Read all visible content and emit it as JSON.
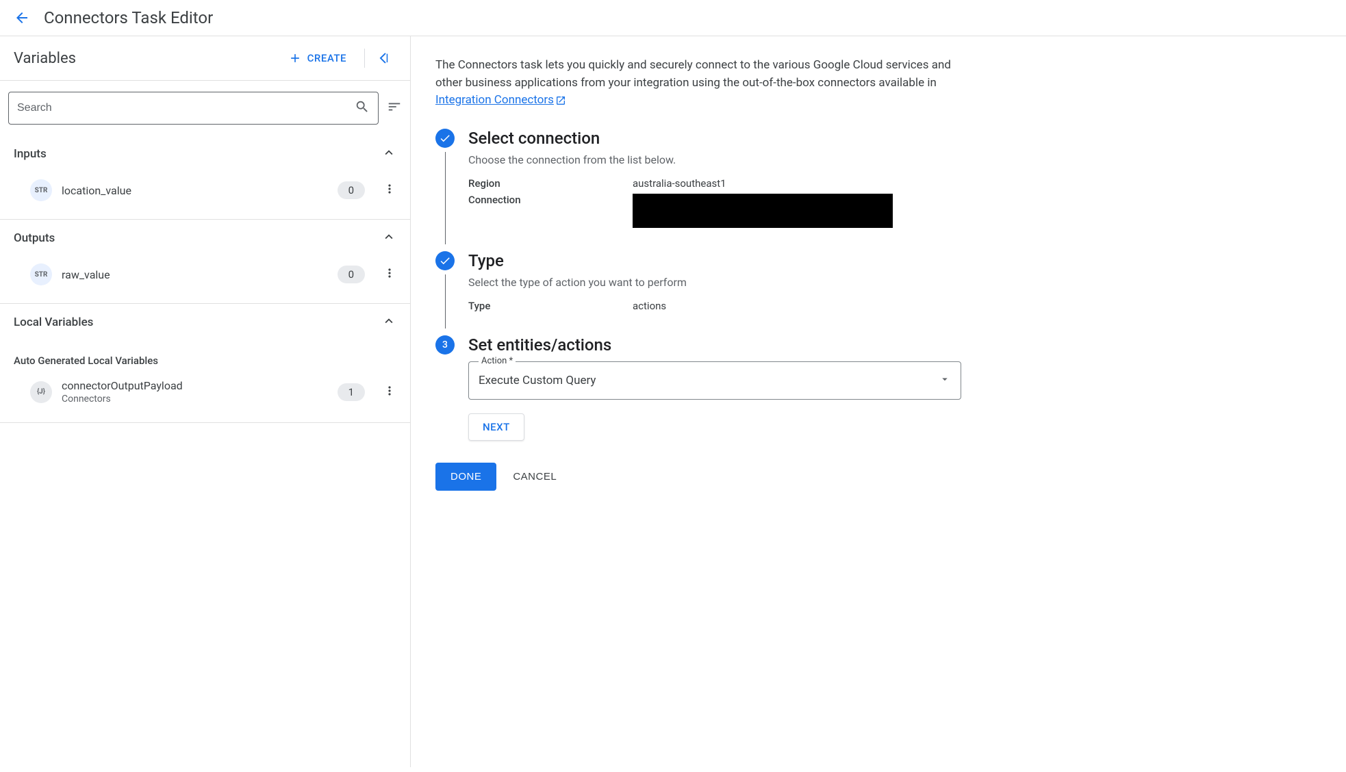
{
  "header": {
    "title": "Connectors Task Editor"
  },
  "leftPanel": {
    "title": "Variables",
    "createLabel": "CREATE",
    "searchPlaceholder": "Search",
    "sections": {
      "inputs": {
        "title": "Inputs",
        "items": [
          {
            "type": "STR",
            "name": "location_value",
            "count": "0"
          }
        ]
      },
      "outputs": {
        "title": "Outputs",
        "items": [
          {
            "type": "STR",
            "name": "raw_value",
            "count": "0"
          }
        ]
      },
      "localVars": {
        "title": "Local Variables",
        "subtitle": "Auto Generated Local Variables",
        "items": [
          {
            "type": "{J}",
            "name": "connectorOutputPayload",
            "subtitle": "Connectors",
            "count": "1"
          }
        ]
      }
    }
  },
  "rightPanel": {
    "introText": "The Connectors task lets you quickly and securely connect to the various Google Cloud services and other business applications from your integration using the out-of-the-box connectors available in ",
    "introLink": "Integration Connectors",
    "steps": {
      "step1": {
        "title": "Select connection",
        "desc": "Choose the connection from the list below.",
        "regionLabel": "Region",
        "regionValue": "australia-southeast1",
        "connectionLabel": "Connection"
      },
      "step2": {
        "title": "Type",
        "desc": "Select the type of action you want to perform",
        "typeLabel": "Type",
        "typeValue": "actions"
      },
      "step3": {
        "number": "3",
        "title": "Set entities/actions",
        "actionLabel": "Action *",
        "actionValue": "Execute Custom Query",
        "nextLabel": "NEXT"
      }
    },
    "doneLabel": "DONE",
    "cancelLabel": "CANCEL"
  }
}
